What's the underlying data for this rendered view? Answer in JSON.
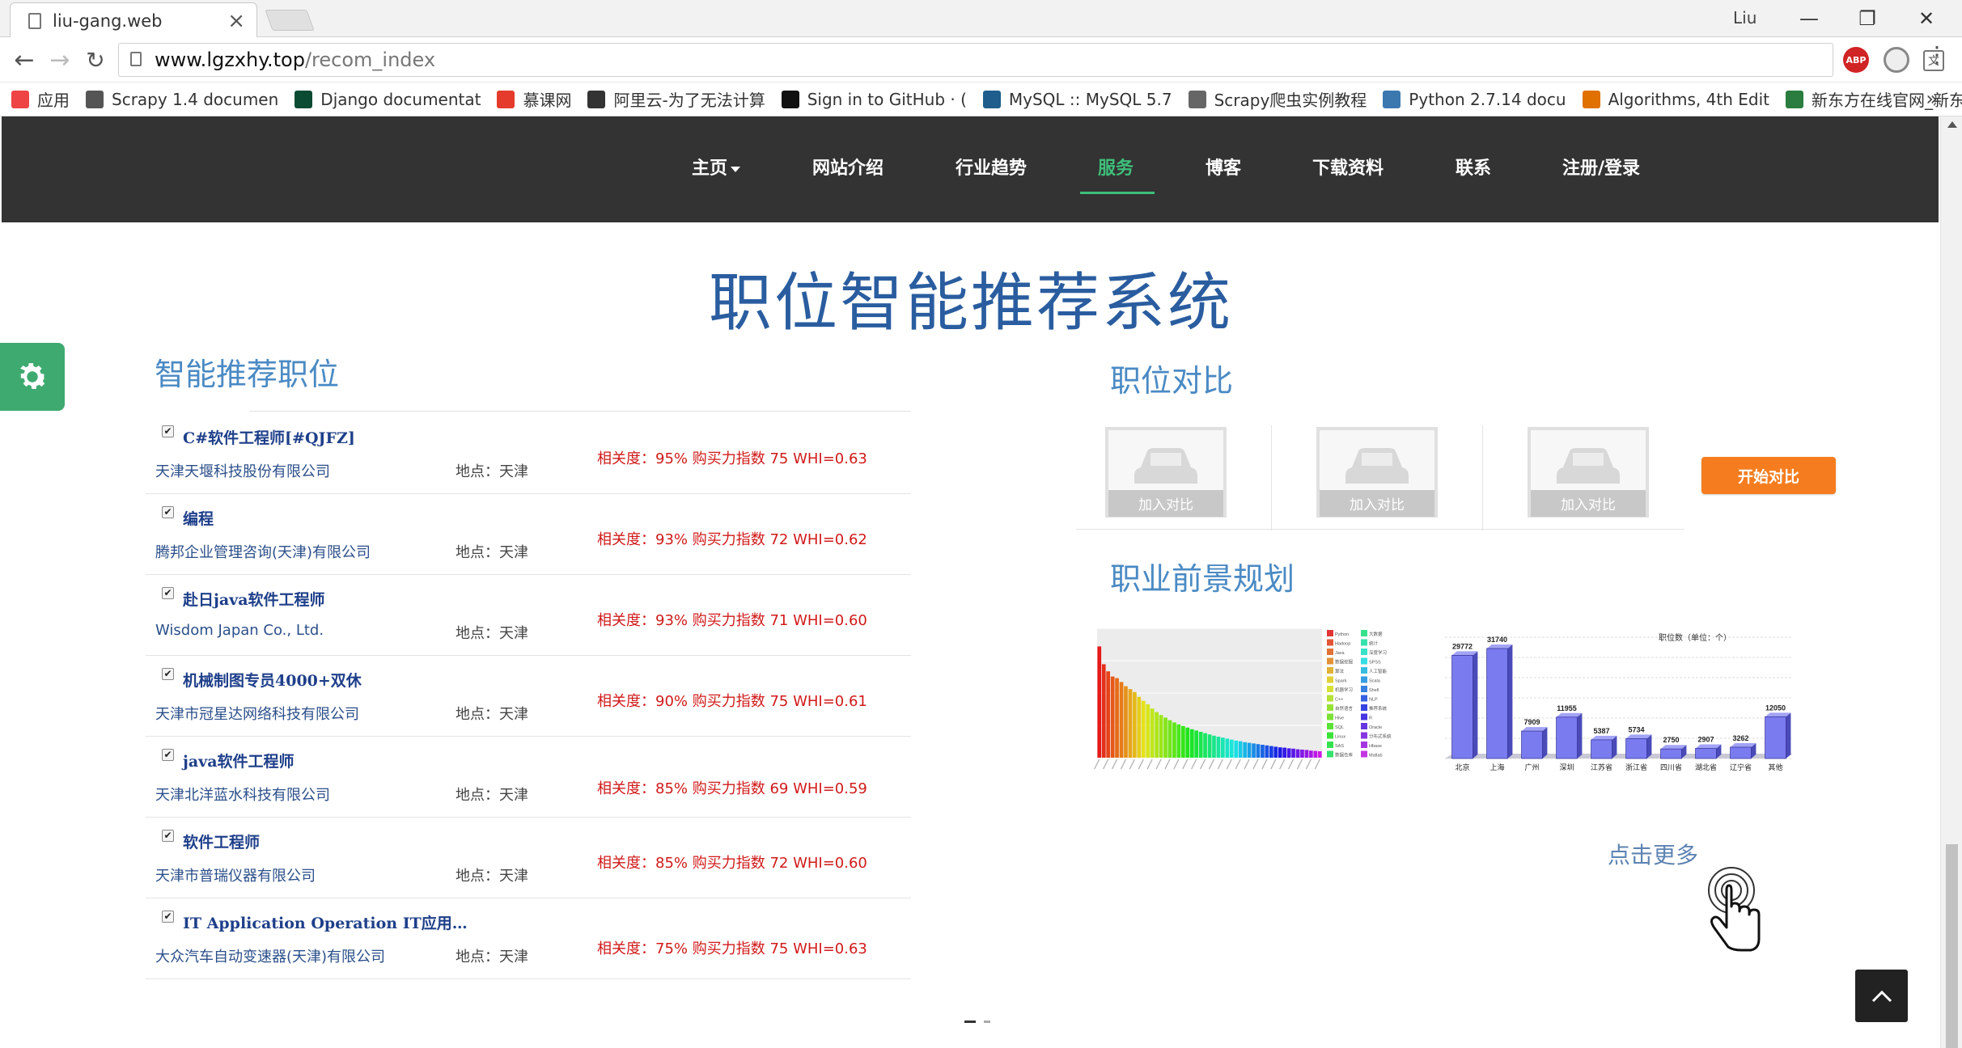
{
  "browser": {
    "tab_title": "liu-gang.web",
    "profile": "Liu",
    "url_host": "www.lgzxhy.top",
    "url_path": "/recom_index",
    "bookmarks": [
      {
        "label": "应用",
        "icon": "apps-grid-icon",
        "color": "#e44"
      },
      {
        "label": "Scrapy 1.4 documen",
        "icon": "doc-icon",
        "color": "#555"
      },
      {
        "label": "Django documentat",
        "icon": "django-icon",
        "color": "#0c4b33"
      },
      {
        "label": "慕课网",
        "icon": "flame-icon",
        "color": "#e53b2c"
      },
      {
        "label": "阿里云-为了无法计算",
        "icon": "aliyun-icon",
        "color": "#333"
      },
      {
        "label": "Sign in to GitHub · (",
        "icon": "github-icon",
        "color": "#111"
      },
      {
        "label": "MySQL :: MySQL 5.7",
        "icon": "mysql-icon",
        "color": "#1f5e8c"
      },
      {
        "label": "Scrapy爬虫实例教程",
        "icon": "scrapy-icon",
        "color": "#666"
      },
      {
        "label": "Python 2.7.14 docu",
        "icon": "python-icon",
        "color": "#3b78b0"
      },
      {
        "label": "Algorithms, 4th Edit",
        "icon": "princeton-icon",
        "color": "#e07000"
      },
      {
        "label": "新东方在线官网_新东",
        "icon": "xdf-icon",
        "color": "#2a7d3e"
      }
    ],
    "more": "»"
  },
  "nav": {
    "items": [
      {
        "label": "主页",
        "dropdown": true
      },
      {
        "label": "网站介绍"
      },
      {
        "label": "行业趋势"
      },
      {
        "label": "服务",
        "active": true
      },
      {
        "label": "博客"
      },
      {
        "label": "下载资料"
      },
      {
        "label": "联系"
      },
      {
        "label": "注册/登录"
      }
    ],
    "active_color": "#3ebf7a",
    "bg_color": "#333333"
  },
  "page": {
    "title": "职位智能推荐系统",
    "rec_title": "智能推荐职位",
    "compare_title": "职位对比",
    "career_title": "职业前景规划",
    "more_link": "点击更多",
    "title_color": "#2a5d9f"
  },
  "jobs": [
    {
      "title": "C#软件工程师[#QJFZ]",
      "company": "天津天堰科技股份有限公司",
      "location": "地点：天津",
      "score": "相关度：95%   购买力指数 75 WHI=0.63"
    },
    {
      "title": "编程",
      "company": "腾邦企业管理咨询(天津)有限公司",
      "location": "地点：天津",
      "score": "相关度：93% 购买力指数 72 WHI=0.62"
    },
    {
      "title": "赴日java软件工程师",
      "company": "Wisdom Japan Co., Ltd.",
      "location": "地点：天津",
      "score": "相关度：93% 购买力指数 71 WHI=0.60"
    },
    {
      "title": "机械制图专员4000+双休",
      "company": "天津市冠星达网络科技有限公司",
      "location": "地点：天津",
      "score": "相关度：90% 购买力指数 75 WHI=0.61"
    },
    {
      "title": "java软件工程师",
      "company": "天津北洋蓝水科技有限公司",
      "location": "地点：天津",
      "score": "相关度：85% 购买力指数 69 WHI=0.59"
    },
    {
      "title": "软件工程师",
      "company": "天津市普瑞仪器有限公司",
      "location": "地点：天津",
      "score": "相关度：85% 购买力指数 72 WHI=0.60"
    },
    {
      "title": "IT Application Operation IT应用…",
      "company": "大众汽车自动变速器(天津)有限公司",
      "location": "地点：天津",
      "score": "相关度：75% 购买力指数 75 WHI=0.63"
    }
  ],
  "compare": {
    "add_label": "加入对比",
    "start_label": "开始对比",
    "button_color": "#f57d1f"
  },
  "chart_data": [
    {
      "type": "bar",
      "title": "",
      "note": "",
      "series_colors": "rainbow gradient",
      "values": [
        344,
        289,
        267,
        251,
        246,
        234,
        221,
        212,
        203,
        188,
        176,
        165,
        152,
        141,
        132,
        124,
        116,
        109,
        103,
        98,
        93,
        88,
        84,
        80,
        76,
        72,
        68,
        65,
        62,
        59,
        56,
        53,
        51,
        48,
        46,
        44,
        42,
        40,
        38,
        36,
        34,
        32,
        31,
        29,
        28,
        26,
        25,
        24,
        22,
        21,
        20
      ],
      "ylim": [
        0,
        400
      ],
      "legend": [
        "Python",
        "Hadoop",
        "Java",
        "数据挖掘",
        "算法",
        "Spark",
        "机器学习",
        "C++",
        "自然语言",
        "Hive",
        "SQL",
        "Linux",
        "SAS",
        "数据仓库",
        "大数据",
        "统计",
        "深度学习",
        "SPSS",
        "人工智能",
        "Scala",
        "Shell",
        "NLP",
        "推荐系统",
        "R",
        "Oracle",
        "分布式系统",
        "Hbase",
        "Matlab"
      ]
    },
    {
      "type": "bar",
      "title": "职位数（单位：个）",
      "categories": [
        "北京",
        "上海",
        "广州",
        "深圳",
        "江苏省",
        "浙江省",
        "四川省",
        "湖北省",
        "辽宁省",
        "其他"
      ],
      "values": [
        29772,
        31740,
        7909,
        11955,
        5387,
        5734,
        2750,
        2907,
        3262,
        12050
      ],
      "ylim": [
        0,
        35000
      ],
      "color": "#7b7bf0"
    }
  ]
}
